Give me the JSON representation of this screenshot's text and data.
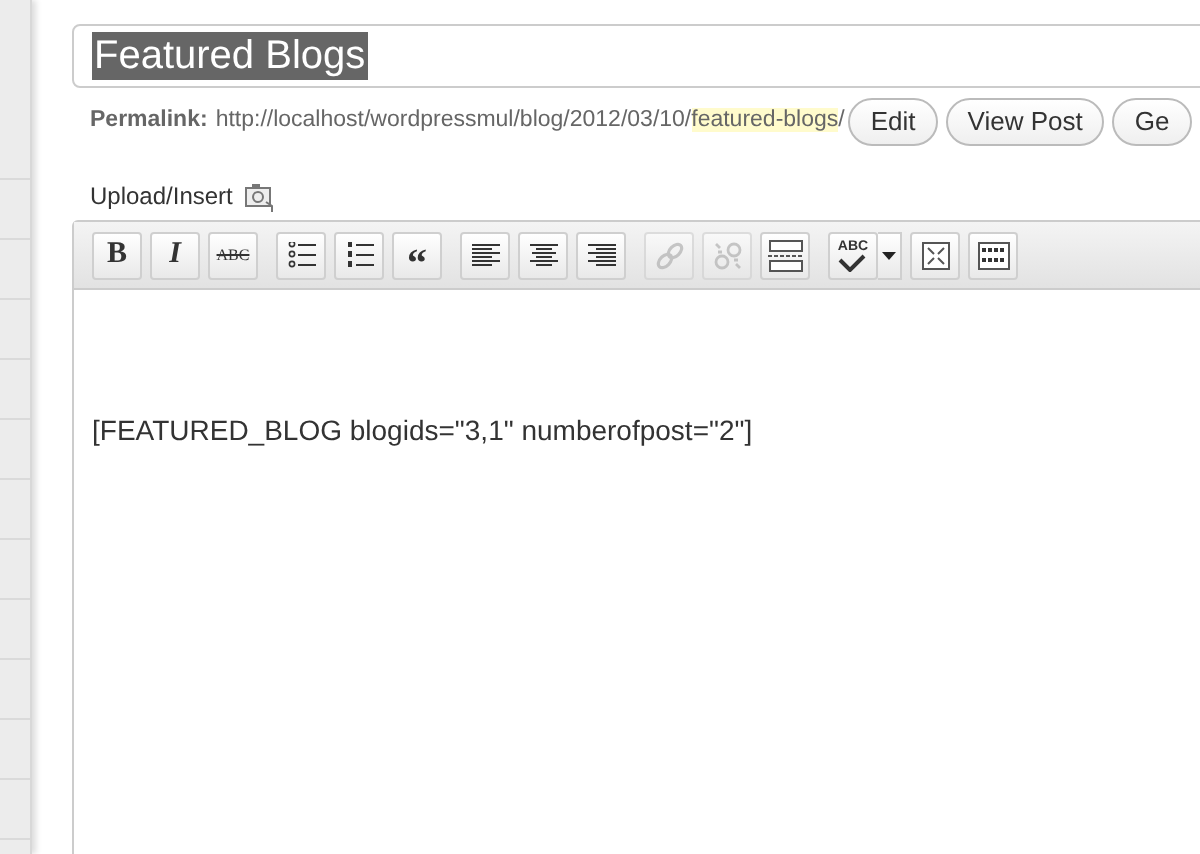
{
  "title_field": {
    "value": "Featured Blogs",
    "selected": true
  },
  "permalink": {
    "label": "Permalink:",
    "base": "http://localhost/wordpressmul/blog/2012/03/10/",
    "slug": "featured-blogs",
    "suffix": "/"
  },
  "permalink_buttons": [
    "Edit",
    "View Post",
    "Ge"
  ],
  "upload_insert": {
    "label": "Upload/Insert"
  },
  "toolbar": [
    [
      {
        "kind": "bold",
        "glyph": "B"
      },
      {
        "kind": "italic",
        "glyph": "I"
      },
      {
        "kind": "strike",
        "glyph": "ABC"
      }
    ],
    [
      {
        "kind": "bullets"
      },
      {
        "kind": "numbers"
      },
      {
        "kind": "quote",
        "glyph": "“"
      }
    ],
    [
      {
        "kind": "align-left"
      },
      {
        "kind": "align-center"
      },
      {
        "kind": "align-right"
      }
    ],
    [
      {
        "kind": "link",
        "disabled": true
      },
      {
        "kind": "unlink",
        "disabled": true
      },
      {
        "kind": "more"
      }
    ],
    [
      {
        "kind": "spellcheck",
        "glyph": "ABC"
      },
      {
        "kind": "fullscreen"
      },
      {
        "kind": "kitchen-sink"
      }
    ]
  ],
  "editor": {
    "content": "[FEATURED_BLOG blogids=\"3,1\" numberofpost=\"2\"]"
  }
}
